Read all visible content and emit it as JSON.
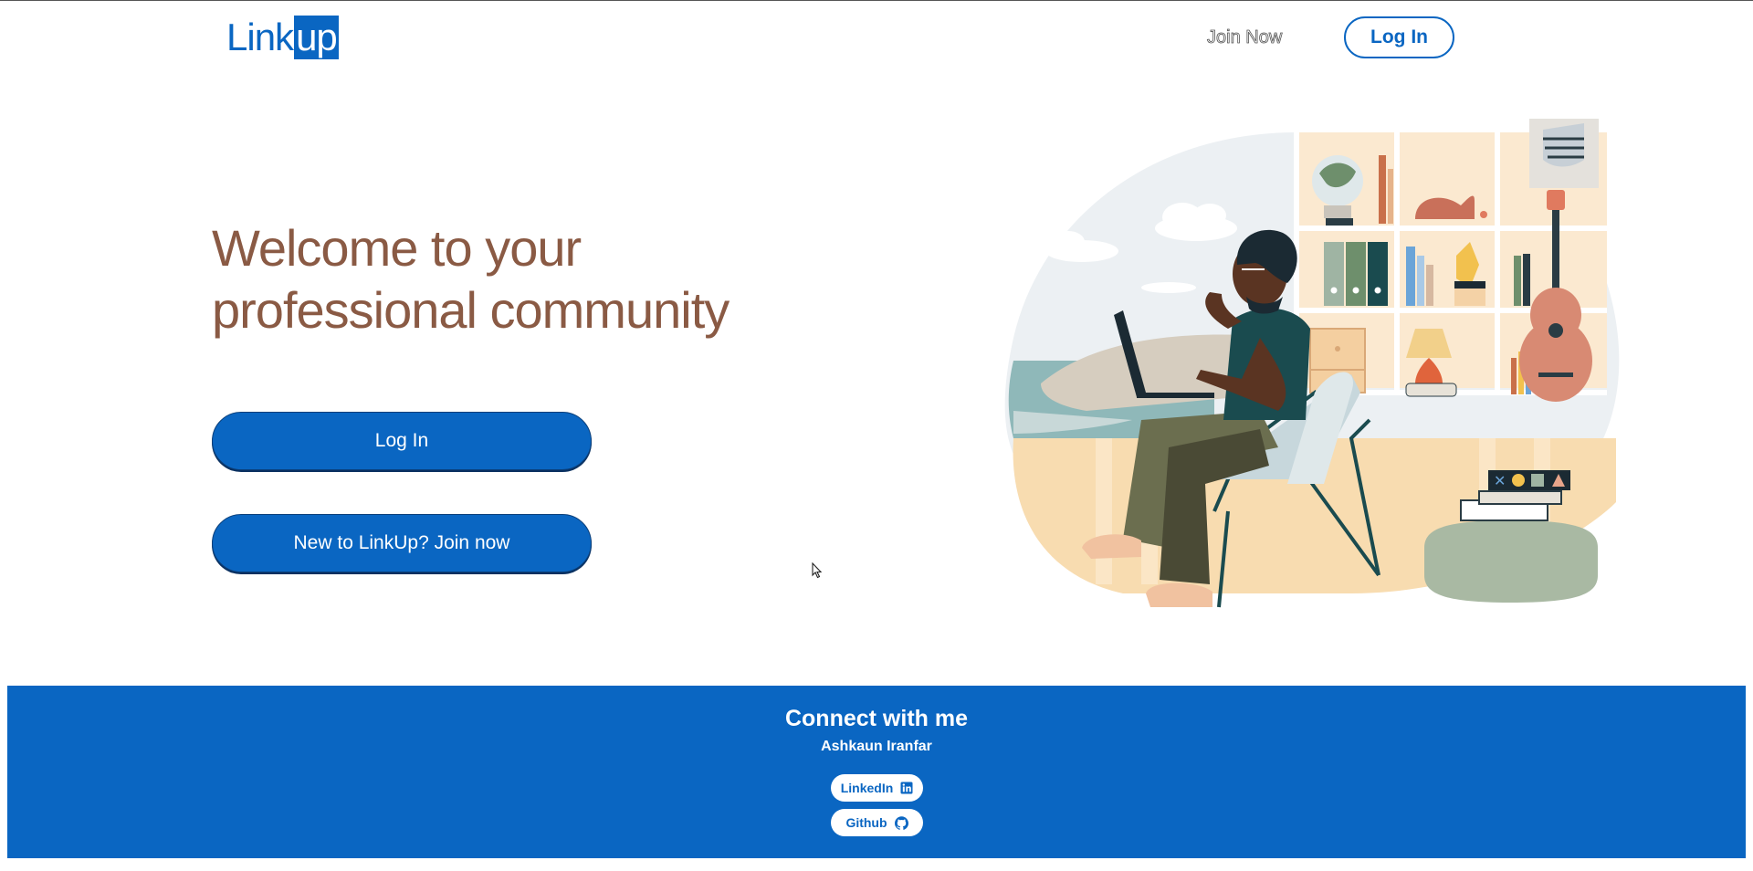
{
  "header": {
    "logo_left": "Link",
    "logo_right": "up",
    "join_now_label": "Join Now",
    "login_label": "Log In"
  },
  "hero": {
    "title": "Welcome to your professional community",
    "login_button": "Log In",
    "join_button": "New to LinkUp? Join now"
  },
  "footer": {
    "title": "Connect with me",
    "name": "Ashkaun Iranfar",
    "linkedin_label": "LinkedIn",
    "linkedin_icon": "linkedin-icon",
    "github_label": "Github",
    "github_icon": "github-icon"
  },
  "colors": {
    "brand_blue": "#0a66c2",
    "title_brown": "#8a5a44"
  }
}
